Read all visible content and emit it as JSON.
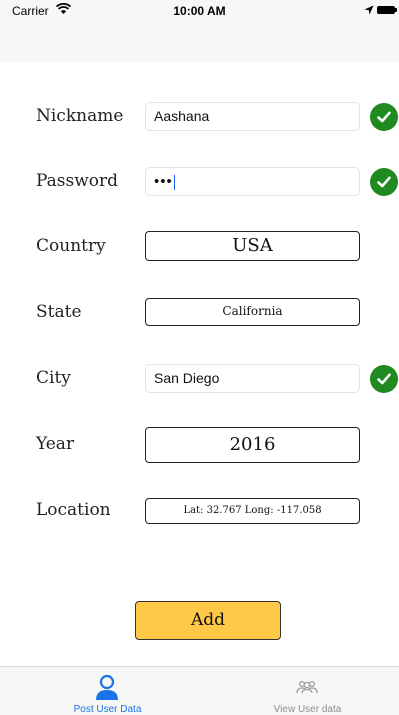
{
  "status_bar": {
    "carrier": "Carrier",
    "time": "10:00 AM"
  },
  "form": {
    "nickname": {
      "label": "Nickname",
      "value": "Aashana"
    },
    "password": {
      "label": "Password",
      "value": "•••"
    },
    "country": {
      "label": "Country",
      "value": "USA"
    },
    "state": {
      "label": "State",
      "value": "California"
    },
    "city": {
      "label": "City",
      "value": "San Diego"
    },
    "year": {
      "label": "Year",
      "value": "2016"
    },
    "location": {
      "label": "Location",
      "value": "Lat: 32.767 Long: -117.058"
    }
  },
  "add_button": {
    "label": "Add"
  },
  "tab_bar": {
    "tabs": [
      {
        "label": "Post User Data",
        "icon": "person-icon",
        "active": true
      },
      {
        "label": "View User data",
        "icon": "people-icon",
        "active": false
      }
    ]
  },
  "colors": {
    "accent": "#1a73e8",
    "check": "#1f8a1f",
    "button": "#ffc847"
  }
}
